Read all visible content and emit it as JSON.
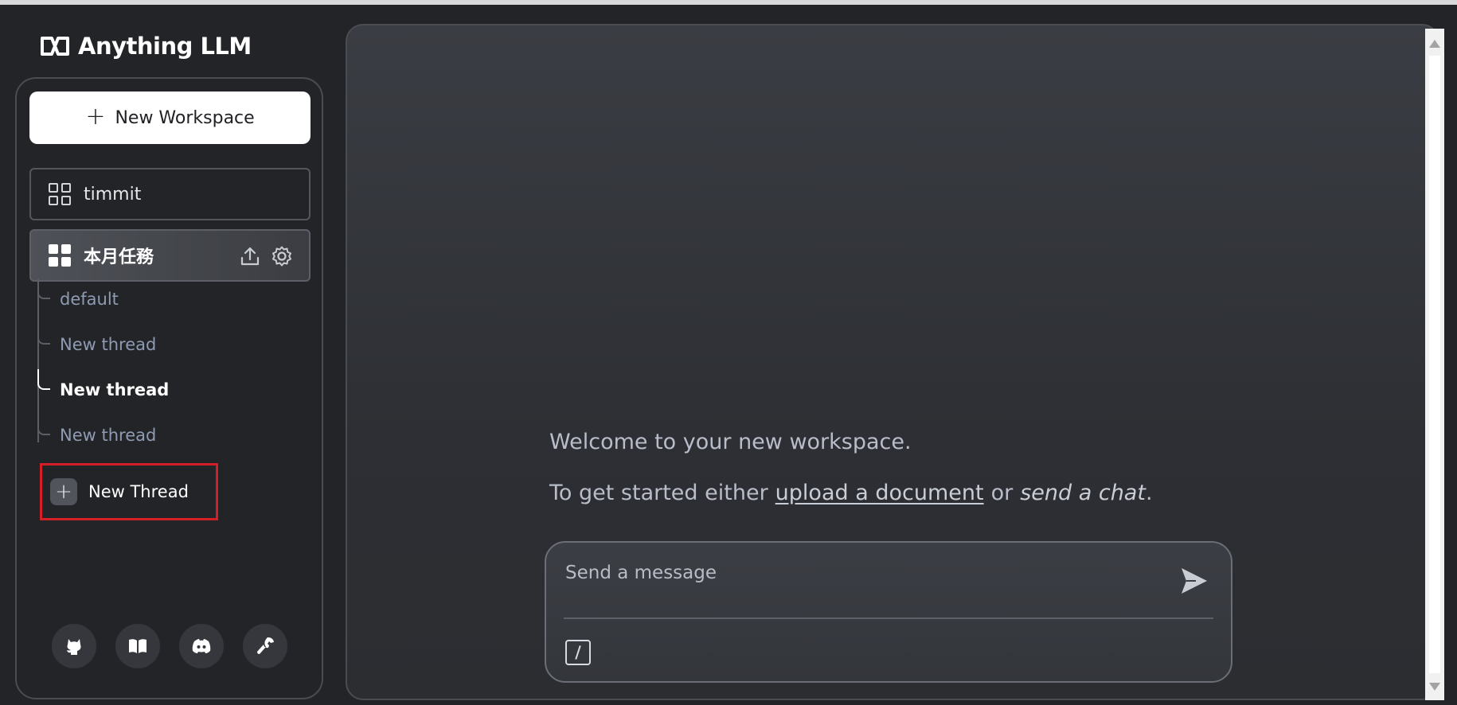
{
  "app": {
    "name": "Anything LLM"
  },
  "sidebar": {
    "new_workspace_label": "New Workspace",
    "workspaces": [
      {
        "label": "timmit",
        "active": false
      },
      {
        "label": "本月任務",
        "active": true
      }
    ],
    "threads": [
      {
        "label": "default",
        "current": false
      },
      {
        "label": "New thread",
        "current": false
      },
      {
        "label": "New thread",
        "current": true
      },
      {
        "label": "New thread",
        "current": false
      }
    ],
    "new_thread_label": "New Thread",
    "footer_icons": [
      "github-icon",
      "book-icon",
      "discord-icon",
      "wrench-icon"
    ],
    "highlight_color": "#d41f26"
  },
  "main": {
    "welcome": "Welcome to your new workspace.",
    "started_prefix": "To get started either",
    "upload_link": "upload a document",
    "or_text": "or",
    "send_chat": "send a chat",
    "period": ".",
    "input_placeholder": "Send a message"
  }
}
